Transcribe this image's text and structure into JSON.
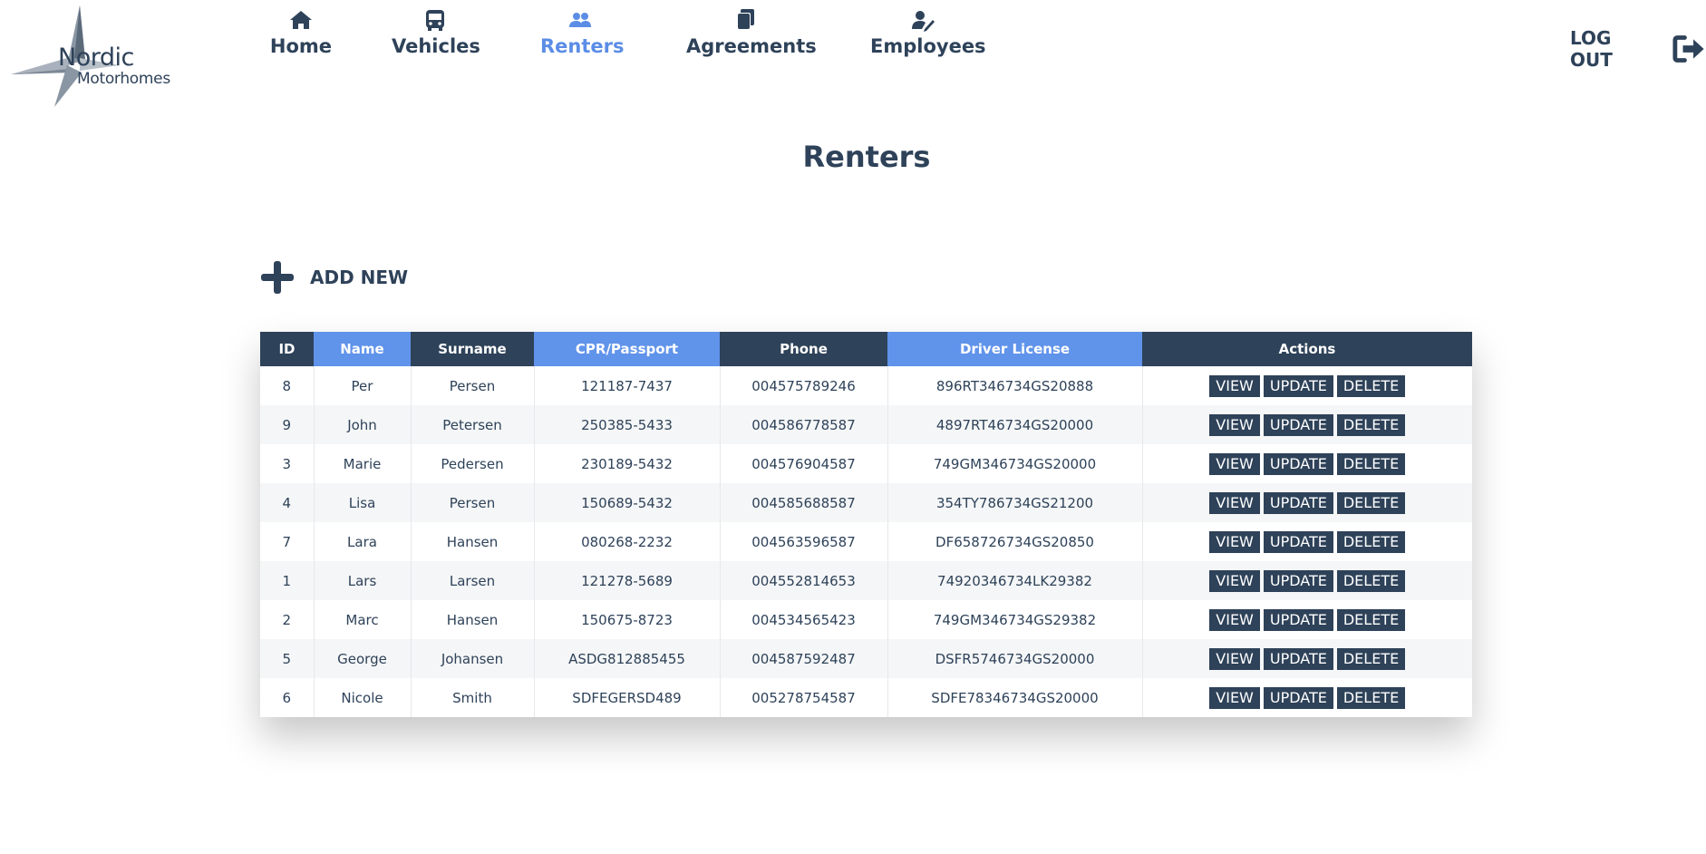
{
  "logo": {
    "line1": "Nordic",
    "line2": "Motorhomes"
  },
  "nav": {
    "items": [
      {
        "label": "Home",
        "icon": "home-icon"
      },
      {
        "label": "Vehicles",
        "icon": "bus-icon"
      },
      {
        "label": "Renters",
        "icon": "users-icon",
        "active": true
      },
      {
        "label": "Agreements",
        "icon": "documents-icon"
      },
      {
        "label": "Employees",
        "icon": "user-edit-icon"
      }
    ],
    "logout_label": "LOG OUT"
  },
  "page_title": "Renters",
  "add_new_label": "ADD NEW",
  "colors": {
    "primary": "#2e4259",
    "accent": "#6093ea"
  },
  "table": {
    "headers": [
      "ID",
      "Name",
      "Surname",
      "CPR/Passport",
      "Phone",
      "Driver License",
      "Actions"
    ],
    "actions": [
      "VIEW",
      "UPDATE",
      "DELETE"
    ],
    "rows": [
      [
        "8",
        "Per",
        "Persen",
        "121187-7437",
        "004575789246",
        "896RT346734GS20888"
      ],
      [
        "9",
        "John",
        "Petersen",
        "250385-5433",
        "004586778587",
        "4897RT46734GS20000"
      ],
      [
        "3",
        "Marie",
        "Pedersen",
        "230189-5432",
        "004576904587",
        "749GM346734GS20000"
      ],
      [
        "4",
        "Lisa",
        "Persen",
        "150689-5432",
        "004585688587",
        "354TY786734GS21200"
      ],
      [
        "7",
        "Lara",
        "Hansen",
        "080268-2232",
        "004563596587",
        "DF658726734GS20850"
      ],
      [
        "1",
        "Lars",
        "Larsen",
        "121278-5689",
        "004552814653",
        "74920346734LK29382"
      ],
      [
        "2",
        "Marc",
        "Hansen",
        "150675-8723",
        "004534565423",
        "749GM346734GS29382"
      ],
      [
        "5",
        "George",
        "Johansen",
        "ASDG812885455",
        "004587592487",
        "DSFR5746734GS20000"
      ],
      [
        "6",
        "Nicole",
        "Smith",
        "SDFEGERSD489",
        "005278754587",
        "SDFE78346734GS20000"
      ]
    ]
  }
}
